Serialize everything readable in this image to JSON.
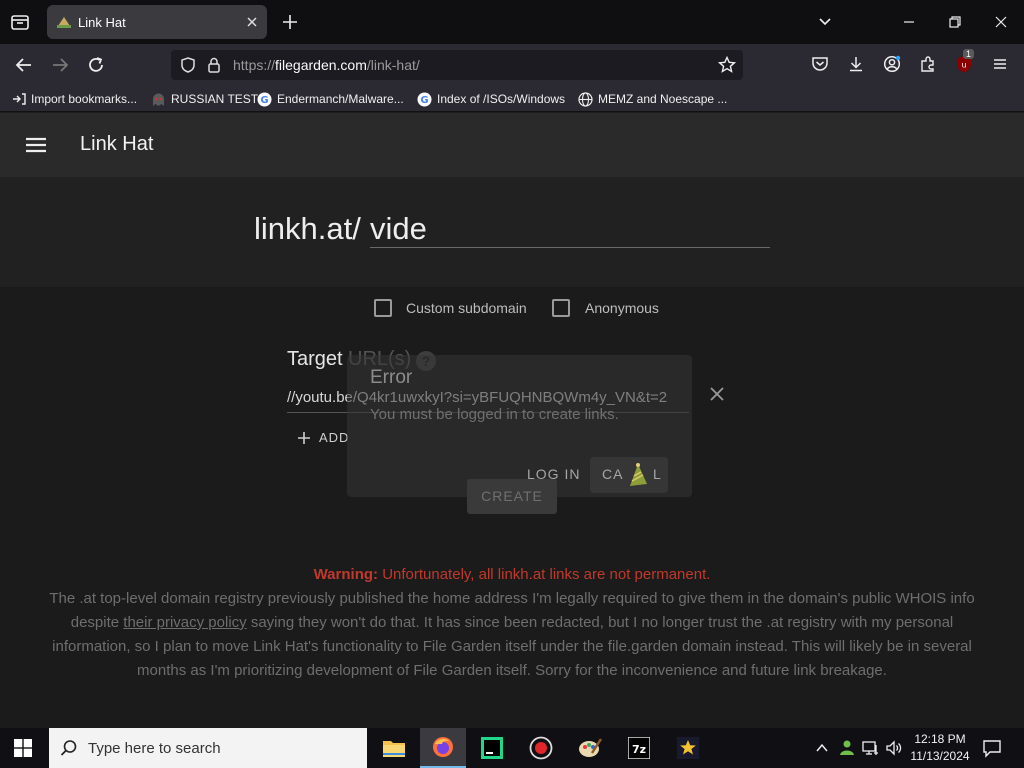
{
  "browser": {
    "tab_title": "Link Hat",
    "url_prefix": "https://",
    "url_host": "filegarden.com",
    "url_path": "/link-hat/",
    "extension_badge": "1",
    "bookmarks": [
      {
        "label": "Import bookmarks...",
        "icon": "import-icon"
      },
      {
        "label": "RUSSIAN TEST",
        "icon": "ghost-icon"
      },
      {
        "label": "Endermanch/Malware...",
        "icon": "google-icon"
      },
      {
        "label": "Index of /ISOs/Windows",
        "icon": "google-icon"
      },
      {
        "label": "MEMZ and Noescape ...",
        "icon": "globe-icon"
      }
    ]
  },
  "app": {
    "title": "Link Hat",
    "link_prefix": "linkh.at/",
    "link_slug": "vide",
    "custom_subdomain_label": "Custom subdomain",
    "anonymous_label": "Anonymous",
    "target_label": "Target",
    "target_label_faded": "URL(s)",
    "target_value": "//youtu.be/Q4kr1uwxkyI?si=yBFUQHNBQWm4y_VN&t=2",
    "add_label": "ADD",
    "create_label": "CREATE",
    "warning_prefix": "Warning:",
    "warning_text": "Unfortunately, all linkh.at links are not permanent.",
    "info_1a": "The .at top-level domain registry previously published the home address I'm legally required to give them in the domain's public WHOIS info",
    "info_2a": "despite ",
    "info_2_link": "their privacy policy",
    "info_2b": " saying they won't do that. It has since been redacted, but I no longer trust the .at registry with my personal",
    "info_3": "information, so I plan to move Link Hat's functionality to File Garden itself under the file.garden domain instead. This will likely be in several",
    "info_4": "months as I'm prioritizing development of File Garden itself. Sorry for the inconvenience and future link breakage."
  },
  "dialog": {
    "title": "Error",
    "message": "You must be logged in to create links.",
    "login_label": "LOG IN",
    "cancel_label_a": "CA",
    "cancel_label_b": "L"
  },
  "taskbar": {
    "search_placeholder": "Type here to search",
    "time": "12:18 PM",
    "date": "11/13/2024"
  },
  "colors": {
    "accent_red": "#c0392b",
    "app_bg": "#1b1b1b",
    "appbar_bg": "#2a2a2a"
  }
}
